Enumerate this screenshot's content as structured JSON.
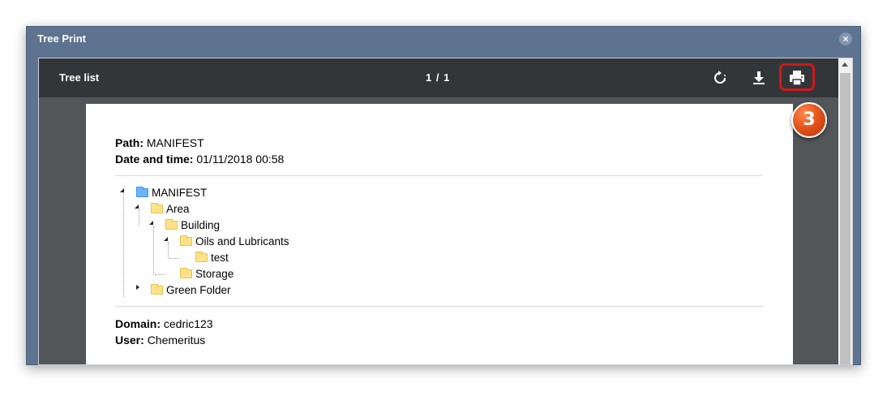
{
  "window": {
    "title": "Tree Print",
    "close_glyph": "×"
  },
  "toolbar": {
    "doc_title": "Tree list",
    "page_indicator": "1 / 1",
    "rotate_icon": "rotate-icon",
    "download_icon": "download-icon",
    "print_icon": "print-icon"
  },
  "annotation": {
    "step": "3",
    "highlight_color": "#d01818",
    "badge_color": "#e5541b"
  },
  "document": {
    "path_label": "Path:",
    "path_value": "MANIFEST",
    "datetime_label": "Date and time:",
    "datetime_value": "01/11/2018 00:58",
    "tree": [
      {
        "label": "MANIFEST",
        "folder": "blue"
      },
      {
        "label": "Area",
        "folder": "yellow"
      },
      {
        "label": "Building",
        "folder": "yellow"
      },
      {
        "label": "Oils and Lubricants",
        "folder": "yellow"
      },
      {
        "label": "test",
        "folder": "yellow"
      },
      {
        "label": "Storage",
        "folder": "yellow"
      },
      {
        "label": "Green Folder",
        "folder": "yellow"
      }
    ],
    "domain_label": "Domain:",
    "domain_value": "cedric123",
    "user_label": "User:",
    "user_value": "Chemeritus"
  }
}
